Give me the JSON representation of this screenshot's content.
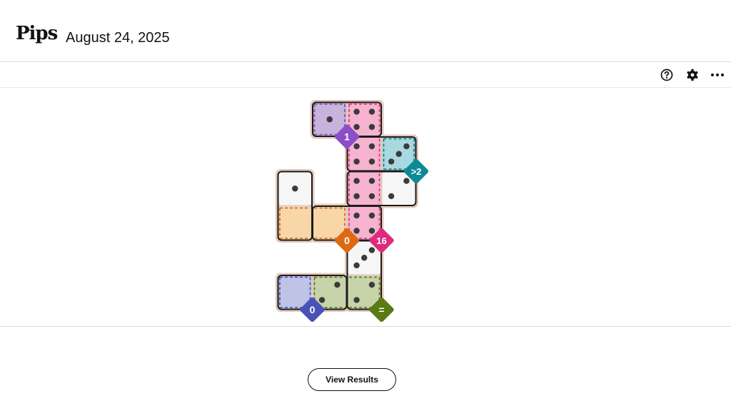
{
  "header": {
    "title": "Pips",
    "date": "August 24, 2025"
  },
  "toolbar": {
    "icons": [
      "help-icon",
      "gear-icon",
      "more-icon"
    ]
  },
  "board": {
    "colors": {
      "purple": "#c7b3dc",
      "pink": "#f5b3cf",
      "teal": "#a8d9e0",
      "orange": "#f8d6a8",
      "blue": "#bfc3e6",
      "green": "#c7d3a8",
      "white": "#f6f6f6"
    },
    "regions": [
      {
        "id": "purple",
        "label": "1",
        "badge_color": "#8a4fc7"
      },
      {
        "id": "teal",
        "label": ">2",
        "badge_color": "#0e8a96"
      },
      {
        "id": "orange",
        "label": "0",
        "badge_color": "#dd6a12"
      },
      {
        "id": "pink",
        "label": "16",
        "badge_color": "#dd2c7e"
      },
      {
        "id": "blue",
        "label": "0",
        "badge_color": "#4a52b8"
      },
      {
        "id": "green",
        "label": "=",
        "badge_color": "#5a7a14"
      }
    ],
    "cells": [
      {
        "r": 0,
        "c": 1,
        "region": "purple",
        "pips": 1
      },
      {
        "r": 0,
        "c": 2,
        "region": "pink",
        "pips": 4
      },
      {
        "r": 1,
        "c": 2,
        "region": "pink",
        "pips": 4
      },
      {
        "r": 1,
        "c": 3,
        "region": "teal",
        "pips": 3
      },
      {
        "r": 2,
        "c": 0,
        "region": "white",
        "pips": 1
      },
      {
        "r": 2,
        "c": 2,
        "region": "pink",
        "pips": 4
      },
      {
        "r": 2,
        "c": 3,
        "region": "white",
        "pips": 2
      },
      {
        "r": 3,
        "c": 0,
        "region": "orange",
        "pips": 0
      },
      {
        "r": 3,
        "c": 1,
        "region": "orange",
        "pips": 0
      },
      {
        "r": 3,
        "c": 2,
        "region": "pink",
        "pips": 4
      },
      {
        "r": 4,
        "c": 2,
        "region": "white",
        "pips": 3
      },
      {
        "r": 5,
        "c": 0,
        "region": "blue",
        "pips": 0
      },
      {
        "r": 5,
        "c": 1,
        "region": "green",
        "pips": 2
      },
      {
        "r": 5,
        "c": 2,
        "region": "green",
        "pips": 2
      }
    ],
    "dominoes": [
      {
        "cells": [
          [
            0,
            1
          ],
          [
            0,
            2
          ]
        ]
      },
      {
        "cells": [
          [
            1,
            2
          ],
          [
            1,
            3
          ]
        ]
      },
      {
        "cells": [
          [
            2,
            2
          ],
          [
            2,
            3
          ]
        ]
      },
      {
        "cells": [
          [
            2,
            0
          ],
          [
            3,
            0
          ]
        ]
      },
      {
        "cells": [
          [
            3,
            1
          ],
          [
            3,
            2
          ]
        ]
      },
      {
        "cells": [
          [
            4,
            2
          ],
          [
            5,
            2
          ]
        ]
      },
      {
        "cells": [
          [
            5,
            0
          ],
          [
            5,
            1
          ]
        ]
      }
    ]
  },
  "footer": {
    "view_results_label": "View Results"
  }
}
